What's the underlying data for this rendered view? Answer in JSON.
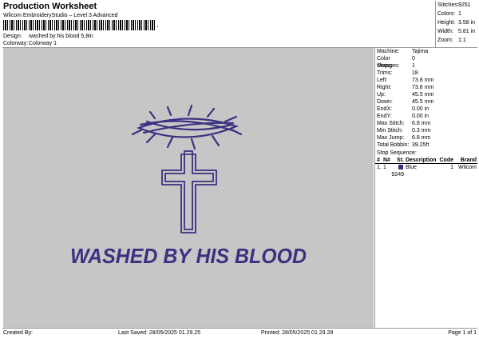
{
  "header": {
    "title": "Production Worksheet",
    "subtitle": "Wilcom EmbroideryStudio – Level 3 Advanced",
    "barcode_tail": ",",
    "design_label": "Design:",
    "design_value": "washed by his blood 5,8in",
    "colorway_label": "Colorway:",
    "colorway_value": "Colorway 1"
  },
  "top_stats": [
    {
      "k": "Stitches:",
      "v": "9251"
    },
    {
      "k": "Colors:",
      "v": "1"
    },
    {
      "k": "Height:",
      "v": "3.58 in"
    },
    {
      "k": "Width:",
      "v": "5.81 in"
    },
    {
      "k": "Zoom:",
      "v": "1:1"
    }
  ],
  "design": {
    "text": "WASHED BY HIS BLOOD",
    "thread_color": "#3a3281",
    "canvas_color": "#c6c6c6"
  },
  "machine_info": [
    {
      "k": "Machine:",
      "v": "Tajima"
    },
    {
      "k": "Color changes:",
      "v": "0"
    },
    {
      "k": "Stops:",
      "v": "1"
    },
    {
      "k": "Trims:",
      "v": "18"
    },
    {
      "k": "Left:",
      "v": "73.8 mm"
    },
    {
      "k": "Right:",
      "v": "73.8 mm"
    },
    {
      "k": "Up:",
      "v": "45.5 mm"
    },
    {
      "k": "Down:",
      "v": "45.5 mm"
    },
    {
      "k": "EndX:",
      "v": "0.00 in"
    },
    {
      "k": "EndY:",
      "v": "0.00 in"
    },
    {
      "k": "Max Stitch:",
      "v": "6.8 mm"
    },
    {
      "k": "Min Stitch:",
      "v": "0.3 mm"
    },
    {
      "k": "Max Jump:",
      "v": "6.8 mm"
    },
    {
      "k": "Total Bobbin:",
      "v": "39.25ft"
    }
  ],
  "stop_sequence": {
    "title": "Stop Sequence:",
    "headers": [
      "#",
      "N#",
      "St.",
      "Description",
      "Code",
      "Brand"
    ],
    "rows": [
      {
        "num": "1.",
        "n": "1",
        "st": "9249",
        "desc": "Blue",
        "code": "1",
        "brand": "Wilcom",
        "color": "#3a3281"
      }
    ]
  },
  "footer": {
    "created_by": "Created By:",
    "last_saved": "Last Saved: 28/05/2025 01.29.25",
    "printed": "Printed: 28/05/2025 01.29.28",
    "page": "Page 1 of 1"
  }
}
